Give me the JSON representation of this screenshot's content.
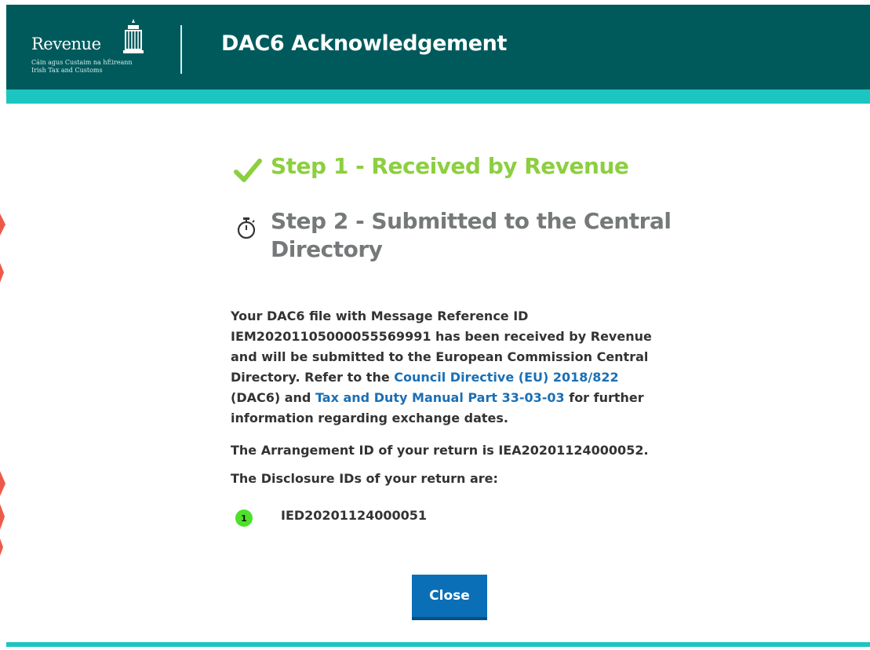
{
  "header": {
    "logo": {
      "name": "Revenue",
      "subtitle_irish": "Cáin agus Custaim na hÉireann",
      "subtitle_english": "Irish Tax and Customs"
    },
    "title": "DAC6 Acknowledgement"
  },
  "steps": [
    {
      "label": "Step 1 - Received by Revenue",
      "icon": "checkmark-icon",
      "color": "#8ccf3f"
    },
    {
      "label": "Step 2 - Submitted to the Central Directory",
      "icon": "stopwatch-icon",
      "color": "#76797a"
    }
  ],
  "message": {
    "p1_part1": "Your DAC6 file with Message Reference ID IEM20201105000055569991 has been received by Revenue and will be submitted to the European Commission Central Directory. Refer to the ",
    "link_directive": "Council Directive (EU) 2018/822",
    "p1_part2": " (DAC6) and ",
    "link_manual": "Tax and Duty Manual Part 33-03-03",
    "p1_part3": " for further information regarding exchange dates.",
    "arrangement": "The Arrangement ID of your return is IEA20201124000052.",
    "disclosure_heading": "The Disclosure IDs of your return are:"
  },
  "disclosure_ids": [
    {
      "number": "1",
      "id": "IED20201124000051"
    }
  ],
  "buttons": {
    "close_label": "Close"
  },
  "colors": {
    "header_bg": "#005a5c",
    "accent_stripe": "#1bc6c1",
    "step_done": "#8ccf3f",
    "link": "#1a6fb5",
    "button": "#0a6fb7",
    "badge": "#4ee02a"
  }
}
